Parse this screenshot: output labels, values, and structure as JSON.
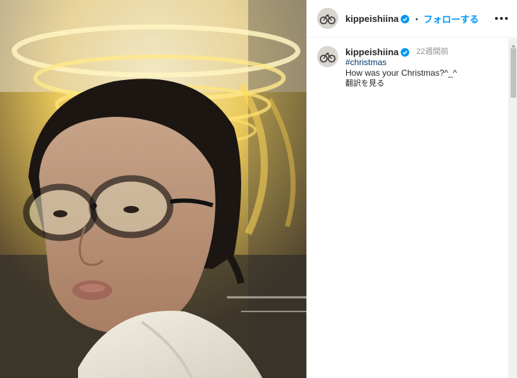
{
  "post": {
    "username": "kippeishiina",
    "follow_label": "フォローする",
    "separator": "・"
  },
  "caption": {
    "username": "kippeishiina",
    "time": "22週間前",
    "hashtag": "#christmas",
    "text": "How was your Christmas?^_^",
    "translate_label": "翻訳を見る"
  },
  "icons": {
    "verified": "verified-badge-icon",
    "more": "more-options-icon",
    "scroll_up": "scroll-up-arrow-icon"
  },
  "colors": {
    "follow": "#0095f6",
    "verified": "#0095f6",
    "hashtag": "#00376b",
    "muted": "#8e8e8e"
  }
}
